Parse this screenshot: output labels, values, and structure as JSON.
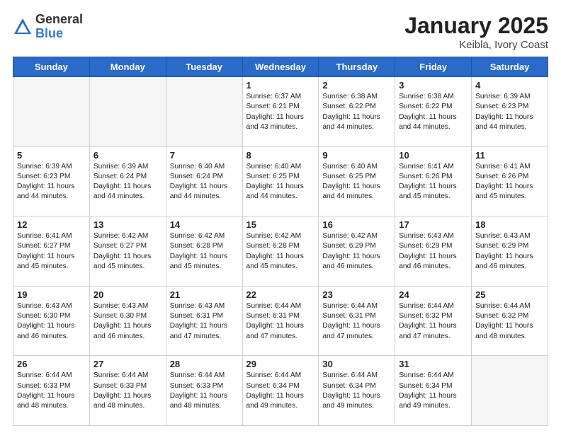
{
  "logo": {
    "general": "General",
    "blue": "Blue"
  },
  "title": "January 2025",
  "subtitle": "Keibla, Ivory Coast",
  "days_header": [
    "Sunday",
    "Monday",
    "Tuesday",
    "Wednesday",
    "Thursday",
    "Friday",
    "Saturday"
  ],
  "weeks": [
    [
      {
        "day": "",
        "info": ""
      },
      {
        "day": "",
        "info": ""
      },
      {
        "day": "",
        "info": ""
      },
      {
        "day": "1",
        "info": "Sunrise: 6:37 AM\nSunset: 6:21 PM\nDaylight: 11 hours\nand 43 minutes."
      },
      {
        "day": "2",
        "info": "Sunrise: 6:38 AM\nSunset: 6:22 PM\nDaylight: 11 hours\nand 44 minutes."
      },
      {
        "day": "3",
        "info": "Sunrise: 6:38 AM\nSunset: 6:22 PM\nDaylight: 11 hours\nand 44 minutes."
      },
      {
        "day": "4",
        "info": "Sunrise: 6:39 AM\nSunset: 6:23 PM\nDaylight: 11 hours\nand 44 minutes."
      }
    ],
    [
      {
        "day": "5",
        "info": "Sunrise: 6:39 AM\nSunset: 6:23 PM\nDaylight: 11 hours\nand 44 minutes."
      },
      {
        "day": "6",
        "info": "Sunrise: 6:39 AM\nSunset: 6:24 PM\nDaylight: 11 hours\nand 44 minutes."
      },
      {
        "day": "7",
        "info": "Sunrise: 6:40 AM\nSunset: 6:24 PM\nDaylight: 11 hours\nand 44 minutes."
      },
      {
        "day": "8",
        "info": "Sunrise: 6:40 AM\nSunset: 6:25 PM\nDaylight: 11 hours\nand 44 minutes."
      },
      {
        "day": "9",
        "info": "Sunrise: 6:40 AM\nSunset: 6:25 PM\nDaylight: 11 hours\nand 44 minutes."
      },
      {
        "day": "10",
        "info": "Sunrise: 6:41 AM\nSunset: 6:26 PM\nDaylight: 11 hours\nand 45 minutes."
      },
      {
        "day": "11",
        "info": "Sunrise: 6:41 AM\nSunset: 6:26 PM\nDaylight: 11 hours\nand 45 minutes."
      }
    ],
    [
      {
        "day": "12",
        "info": "Sunrise: 6:41 AM\nSunset: 6:27 PM\nDaylight: 11 hours\nand 45 minutes."
      },
      {
        "day": "13",
        "info": "Sunrise: 6:42 AM\nSunset: 6:27 PM\nDaylight: 11 hours\nand 45 minutes."
      },
      {
        "day": "14",
        "info": "Sunrise: 6:42 AM\nSunset: 6:28 PM\nDaylight: 11 hours\nand 45 minutes."
      },
      {
        "day": "15",
        "info": "Sunrise: 6:42 AM\nSunset: 6:28 PM\nDaylight: 11 hours\nand 45 minutes."
      },
      {
        "day": "16",
        "info": "Sunrise: 6:42 AM\nSunset: 6:29 PM\nDaylight: 11 hours\nand 46 minutes."
      },
      {
        "day": "17",
        "info": "Sunrise: 6:43 AM\nSunset: 6:29 PM\nDaylight: 11 hours\nand 46 minutes."
      },
      {
        "day": "18",
        "info": "Sunrise: 6:43 AM\nSunset: 6:29 PM\nDaylight: 11 hours\nand 46 minutes."
      }
    ],
    [
      {
        "day": "19",
        "info": "Sunrise: 6:43 AM\nSunset: 6:30 PM\nDaylight: 11 hours\nand 46 minutes."
      },
      {
        "day": "20",
        "info": "Sunrise: 6:43 AM\nSunset: 6:30 PM\nDaylight: 11 hours\nand 46 minutes."
      },
      {
        "day": "21",
        "info": "Sunrise: 6:43 AM\nSunset: 6:31 PM\nDaylight: 11 hours\nand 47 minutes."
      },
      {
        "day": "22",
        "info": "Sunrise: 6:44 AM\nSunset: 6:31 PM\nDaylight: 11 hours\nand 47 minutes."
      },
      {
        "day": "23",
        "info": "Sunrise: 6:44 AM\nSunset: 6:31 PM\nDaylight: 11 hours\nand 47 minutes."
      },
      {
        "day": "24",
        "info": "Sunrise: 6:44 AM\nSunset: 6:32 PM\nDaylight: 11 hours\nand 47 minutes."
      },
      {
        "day": "25",
        "info": "Sunrise: 6:44 AM\nSunset: 6:32 PM\nDaylight: 11 hours\nand 48 minutes."
      }
    ],
    [
      {
        "day": "26",
        "info": "Sunrise: 6:44 AM\nSunset: 6:33 PM\nDaylight: 11 hours\nand 48 minutes."
      },
      {
        "day": "27",
        "info": "Sunrise: 6:44 AM\nSunset: 6:33 PM\nDaylight: 11 hours\nand 48 minutes."
      },
      {
        "day": "28",
        "info": "Sunrise: 6:44 AM\nSunset: 6:33 PM\nDaylight: 11 hours\nand 48 minutes."
      },
      {
        "day": "29",
        "info": "Sunrise: 6:44 AM\nSunset: 6:34 PM\nDaylight: 11 hours\nand 49 minutes."
      },
      {
        "day": "30",
        "info": "Sunrise: 6:44 AM\nSunset: 6:34 PM\nDaylight: 11 hours\nand 49 minutes."
      },
      {
        "day": "31",
        "info": "Sunrise: 6:44 AM\nSunset: 6:34 PM\nDaylight: 11 hours\nand 49 minutes."
      },
      {
        "day": "",
        "info": ""
      }
    ]
  ]
}
